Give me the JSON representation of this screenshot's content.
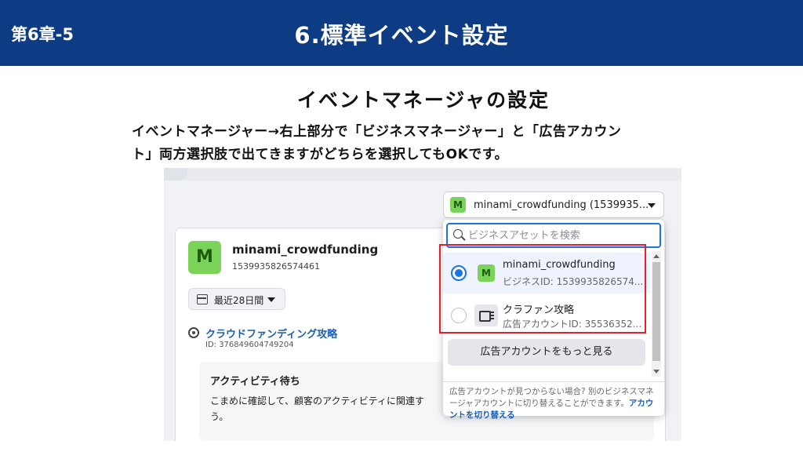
{
  "header": {
    "chapter": "第6章-5",
    "title": "6.標準イベント設定"
  },
  "slide": {
    "subtitle": "イベントマネージャの設定",
    "body_line1": "イベントマネージャー→右上部分で「ビジネスマネージャー」と「広告アカウン",
    "body_line2": "ト」両方選択肢で出てきますがどちらを選択してもOKです。"
  },
  "account_selector": {
    "badge": "M",
    "label": "minami_crowdfunding (1539935..."
  },
  "business_card": {
    "badge": "M",
    "name": "minami_crowdfunding",
    "id": "1539935826574461",
    "date_range_label": "最近28日間",
    "pixel_name": "クラウドファンディング攻略",
    "pixel_id": "ID: 376849604749204",
    "activity_title": "アクティビティ待ち",
    "activity_desc": "こまめに確認して、顧客のアクティビティに関連す う。"
  },
  "dropdown": {
    "search_placeholder": "ビジネスアセットを検索",
    "options": [
      {
        "badge": "M",
        "title": "minami_crowdfunding",
        "subtitle": "ビジネスID: 1539935826574...",
        "selected": true
      },
      {
        "title": "クラファン攻略",
        "subtitle": "広告アカウントID: 35536352...",
        "selected": false
      }
    ],
    "more_button": "広告アカウントをもっと見る",
    "note_text": "広告アカウントが見つからない場合? 別のビジネスマネージャアカウントに切り替えることができます。",
    "note_link": "アカウントを切り替える"
  },
  "colors": {
    "header_bg": "#0d3b84",
    "accent_blue": "#1a73e8",
    "highlight_red": "#e0222b",
    "badge_green": "#7bd35a"
  }
}
